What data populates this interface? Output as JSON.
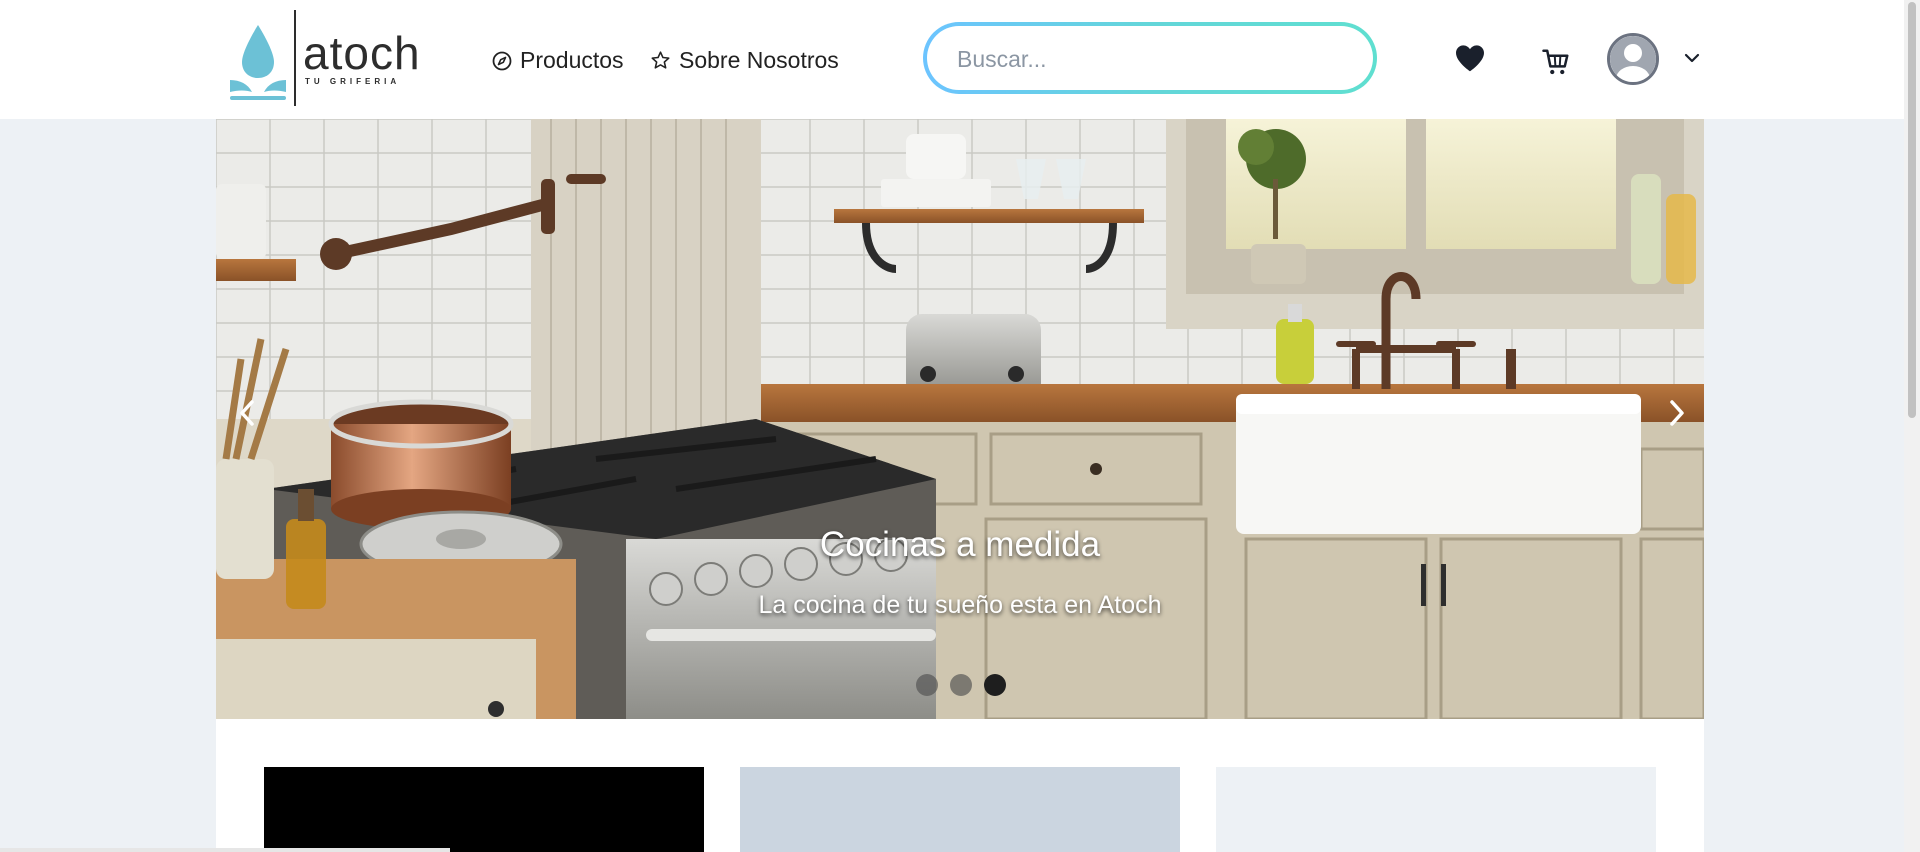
{
  "brand": {
    "name": "atoch",
    "tagline": "TU GRIFERIA",
    "accent_color": "#6cc1d6"
  },
  "nav": [
    {
      "label": "Productos",
      "icon": "compass-icon"
    },
    {
      "label": "Sobre Nosotros",
      "icon": "star-icon"
    }
  ],
  "search": {
    "placeholder": "Buscar...",
    "value": ""
  },
  "header_actions": {
    "favorites_icon": "heart-icon",
    "cart_icon": "cart-icon",
    "user_icon": "user-avatar-icon",
    "menu_icon": "chevron-down-icon"
  },
  "carousel": {
    "title": "Cocinas a medida",
    "subtitle": "La cocina de tu sueño esta en Atoch",
    "slide_count": 3,
    "active_slide": 3,
    "prev_icon": "chevron-left-icon",
    "next_icon": "chevron-right-icon"
  },
  "cards": [
    {
      "color": "#000000"
    },
    {
      "color": "#cbd5e0"
    },
    {
      "color": "#edf1f5"
    }
  ]
}
